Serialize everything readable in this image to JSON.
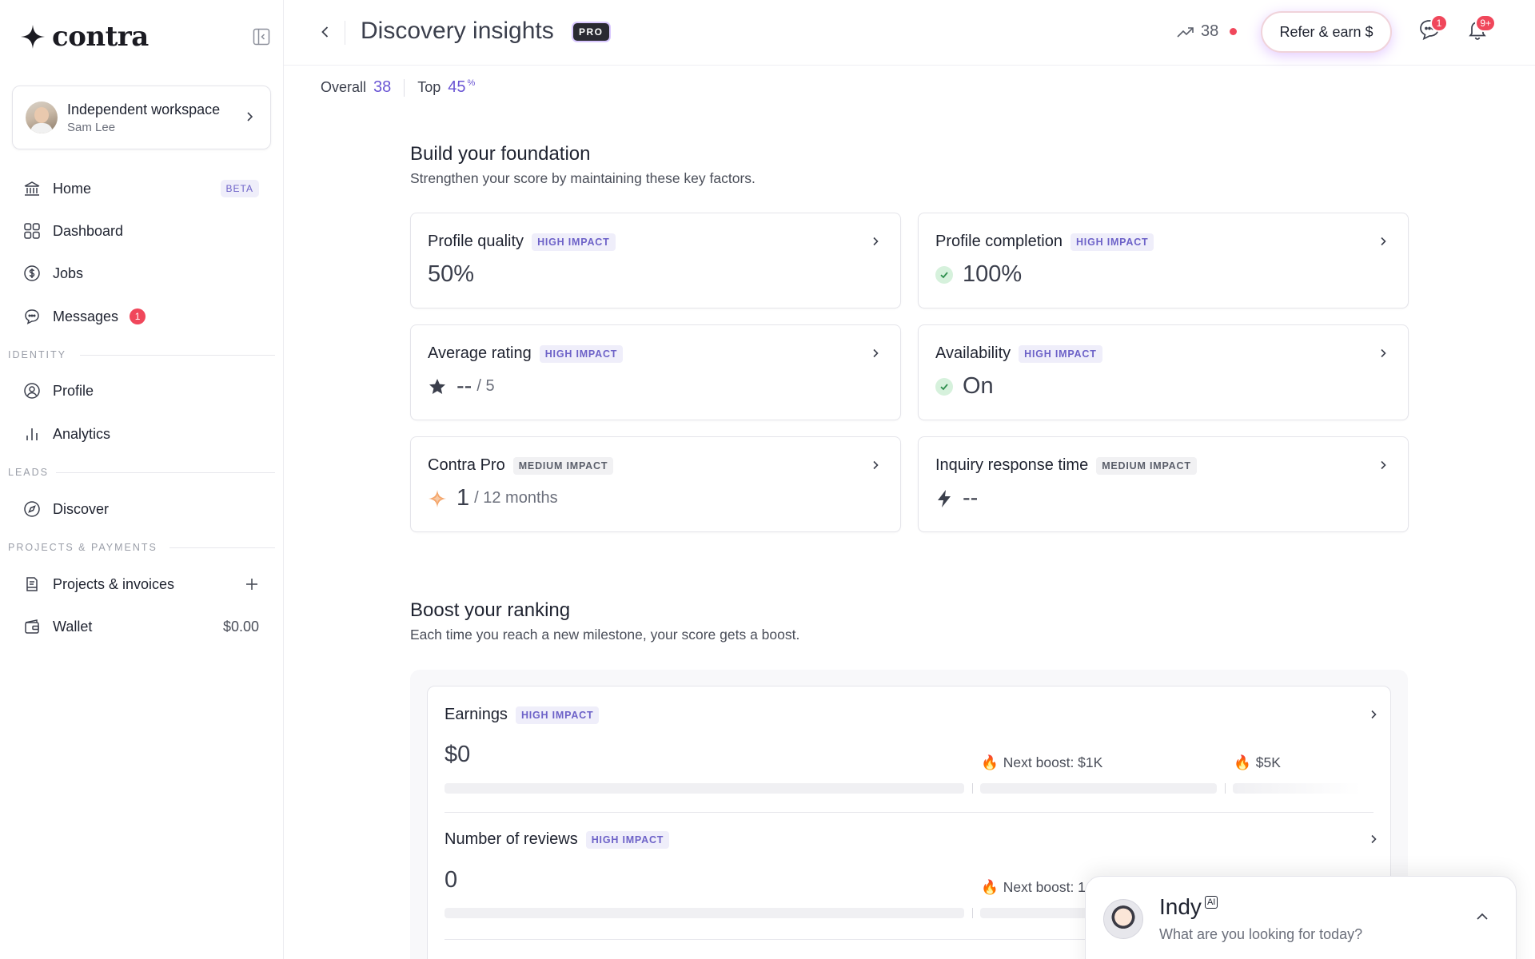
{
  "app": {
    "brand": "contra"
  },
  "workspace": {
    "name": "Independent workspace",
    "user": "Sam Lee"
  },
  "nav": {
    "home": {
      "label": "Home",
      "badge": "BETA"
    },
    "dashboard": {
      "label": "Dashboard"
    },
    "jobs": {
      "label": "Jobs"
    },
    "messages": {
      "label": "Messages",
      "count": "1"
    },
    "section_identity": "IDENTITY",
    "profile": {
      "label": "Profile"
    },
    "analytics": {
      "label": "Analytics"
    },
    "section_leads": "LEADS",
    "discover": {
      "label": "Discover"
    },
    "section_projects": "PROJECTS & PAYMENTS",
    "projects": {
      "label": "Projects & invoices"
    },
    "wallet": {
      "label": "Wallet",
      "value": "$0.00"
    }
  },
  "header": {
    "title": "Discovery insights",
    "pro": "PRO",
    "score": "38",
    "refer": "Refer & earn $",
    "messages_badge": "1",
    "notifications_badge": "9+"
  },
  "summary": {
    "overall_label": "Overall",
    "overall_value": "38",
    "top_label": "Top",
    "top_value": "45",
    "top_unit": "%"
  },
  "foundation": {
    "title": "Build your foundation",
    "subtitle": "Strengthen your score by maintaining these key factors.",
    "cards": [
      {
        "title": "Profile quality",
        "impact": "HIGH IMPACT",
        "value": "50%",
        "suffix": ""
      },
      {
        "title": "Profile completion",
        "impact": "HIGH IMPACT",
        "value": "100%",
        "suffix": ""
      },
      {
        "title": "Average rating",
        "impact": "HIGH IMPACT",
        "value": "--",
        "suffix": "/ 5"
      },
      {
        "title": "Availability",
        "impact": "HIGH IMPACT",
        "value": "On",
        "suffix": ""
      },
      {
        "title": "Contra Pro",
        "impact": "MEDIUM IMPACT",
        "value": "1",
        "suffix": "/ 12 months"
      },
      {
        "title": "Inquiry response time",
        "impact": "MEDIUM IMPACT",
        "value": "--",
        "suffix": ""
      }
    ]
  },
  "ranking": {
    "title": "Boost your ranking",
    "subtitle": "Each time you reach a new milestone, your score gets a boost.",
    "rows": [
      {
        "title": "Earnings",
        "impact": "HIGH IMPACT",
        "value": "$0",
        "next": "Next boost: $1K",
        "next2": "$5K"
      },
      {
        "title": "Number of reviews",
        "impact": "HIGH IMPACT",
        "value": "0",
        "next": "Next boost: 1"
      }
    ]
  },
  "indy": {
    "name": "Indy",
    "tag": "AI",
    "prompt": "What are you looking for today?"
  },
  "colors": {
    "accent": "#6a55d4",
    "badge_red": "#f0475b",
    "impact_bg": "#efeefa"
  }
}
